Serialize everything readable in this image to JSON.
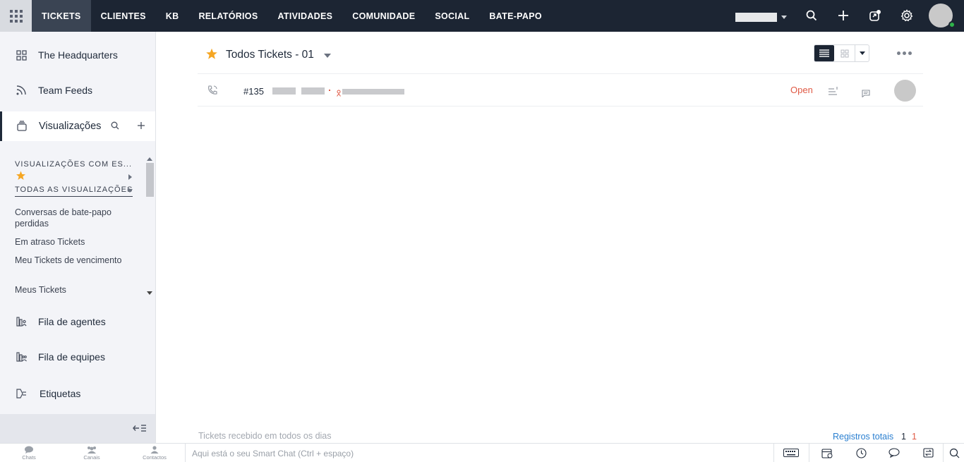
{
  "topbar": {
    "nav_items": [
      "TICKETS",
      "CLIENTES",
      "KB",
      "RELATÓRIOS",
      "ATIVIDADES",
      "COMUNIDADE",
      "SOCIAL",
      "BATE-PAPO"
    ],
    "active_nav": "TICKETS"
  },
  "sidebar": {
    "headquarters": "The Headquarters",
    "team_feeds": "Team Feeds",
    "views": "Visualizações",
    "starred_header": "VISUALIZAÇÕES COM ES...",
    "all_views_header": "TODAS AS VISUALIZAÇÕES",
    "view_links": [
      "Conversas de bate-papo perdidas",
      "Em atraso Tickets",
      "Meu Tickets de vencimento",
      "Meus Tickets"
    ],
    "agent_queue": "Fila de agentes",
    "team_queue": "Fila de equipes",
    "tags": "Etiquetas"
  },
  "main": {
    "view_title": "Todos Tickets - 01",
    "ticket": {
      "id": "#135",
      "status": "Open"
    },
    "footer_text": "Tickets recebido em todos os dias",
    "total_label": "Registros totais",
    "total_value_1": "1",
    "total_value_2": "1"
  },
  "bottombar": {
    "chats": "Chats",
    "channels": "Canais",
    "contacts": "Contactos",
    "smartchat_placeholder": "Aqui está o seu Smart Chat (Ctrl + espaço)"
  },
  "colors": {
    "topbar_bg": "#1c2533",
    "accent_star": "#f5a623",
    "status_open": "#e05a45",
    "link_blue": "#2a7fd0",
    "online": "#2fb34a"
  }
}
